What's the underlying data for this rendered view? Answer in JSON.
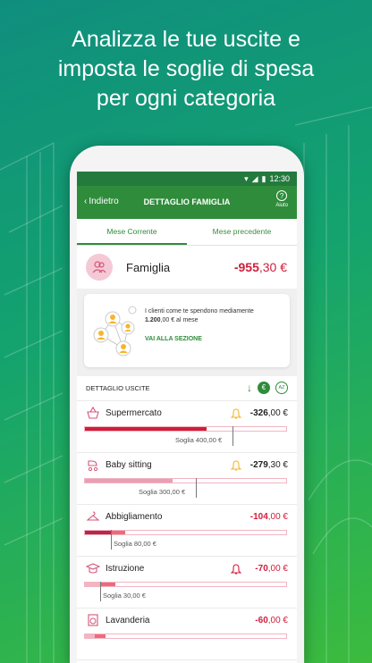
{
  "headline": {
    "line1": "Analizza le tue uscite e",
    "line2": "imposta le soglie di spesa",
    "line3": "per ogni categoria"
  },
  "status_bar": {
    "time": "12:30"
  },
  "app_bar": {
    "back_label": "Indietro",
    "title": "DETTAGLIO FAMIGLIA",
    "help_label": "Aiuto"
  },
  "tabs": [
    {
      "label": "Mese Corrente",
      "active": true
    },
    {
      "label": "Mese precedente",
      "active": false
    }
  ],
  "family": {
    "name": "Famiglia",
    "amount_int": "-955",
    "amount_dec": ",30 €"
  },
  "insight_card": {
    "line1": "I clienti come te spendono mediamente",
    "amount_int": "1.200",
    "amount_rest": ",00 € al mese",
    "link": "VAI ALLA SEZIONE"
  },
  "section": {
    "title": "DETTAGLIO USCITE",
    "sort_amount_icon": "€",
    "sort_az_icon": "AZ"
  },
  "colors": {
    "green": "#2f8c3b",
    "red": "#d11d3a",
    "pink": "#f1b5c2"
  },
  "categories": [
    {
      "name": "Supermercato",
      "amount_int": "-326",
      "amount_dec": ",00 €",
      "icon": "basket-icon",
      "bell": "yellow",
      "amount_red": false,
      "spent_fraction": 0.6,
      "threshold_fraction": 0.73,
      "fill_color": "#d11d3a",
      "over_color": "#d11d3a",
      "threshold": "Soglia 400,00 €"
    },
    {
      "name": "Baby sitting",
      "amount_int": "-279",
      "amount_dec": ",30 €",
      "icon": "stroller-icon",
      "bell": "yellow",
      "amount_red": false,
      "spent_fraction": 0.43,
      "threshold_fraction": 0.55,
      "fill_color": "#e89fb3",
      "over_color": "#e89fb3",
      "threshold": "Soglia 300,00 €"
    },
    {
      "name": "Abbigliamento",
      "amount_int": "-104",
      "amount_dec": ",00 €",
      "icon": "hanger-icon",
      "bell": "none",
      "amount_red": true,
      "spent_fraction": 0.2,
      "threshold_fraction": 0.13,
      "fill_color": "#b8264c",
      "over_color": "#ee6a78",
      "threshold": "Soglia 80,00 €"
    },
    {
      "name": "Istruzione",
      "amount_int": "-70",
      "amount_dec": ",00 €",
      "icon": "graduation-cap-icon",
      "bell": "red",
      "amount_red": true,
      "spent_fraction": 0.15,
      "threshold_fraction": 0.08,
      "fill_color": "#f1b5c2",
      "over_color": "#ee6a78",
      "threshold": "Soglia 30,00 €"
    },
    {
      "name": "Lavanderia",
      "amount_int": "-60",
      "amount_dec": ",00 €",
      "icon": "washing-machine-icon",
      "bell": "none",
      "amount_red": true,
      "spent_fraction": 0.1,
      "threshold_fraction": 0.05,
      "fill_color": "#f1b5c2",
      "over_color": "#ee6a78",
      "threshold": ""
    }
  ]
}
